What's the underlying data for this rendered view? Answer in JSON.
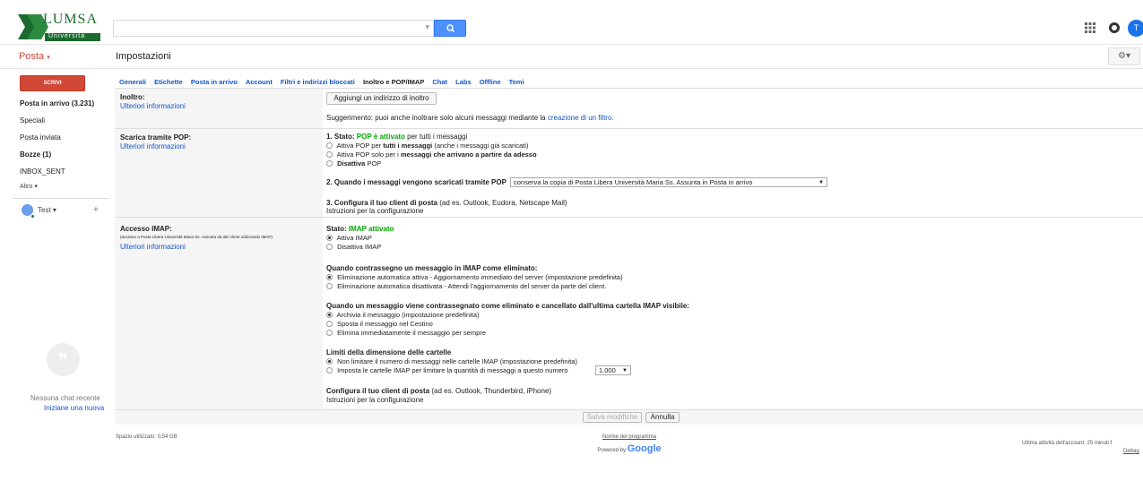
{
  "brand": {
    "name": "LUMSA",
    "subtitle": "Università",
    "color_green": "#1a6b2d"
  },
  "header": {
    "search_value": "",
    "apps_icon": "apps-grid-icon",
    "notif_icon": "notifications-icon",
    "avatar_letter": "T"
  },
  "subbar": {
    "mail_label": "Posta",
    "mail_caret": "▾",
    "page_title": "Impostazioni",
    "gear_label": "⚙▾"
  },
  "sidebar": {
    "compose": "SCRIVI",
    "items": [
      {
        "label": "Posta in arrivo (3.231)"
      },
      {
        "label": "Speciali"
      },
      {
        "label": "Posta inviata"
      },
      {
        "label": "Bozze (1)"
      },
      {
        "label": "INBOX_SENT"
      },
      {
        "label": "Altro ▾"
      }
    ],
    "chat_user": "Test ▾",
    "add_chat": "+",
    "no_chat": "Nessuna chat recente",
    "new_chat": "Iniziane una nuova"
  },
  "tabs": [
    "Generali",
    "Etichette",
    "Posta in arrivo",
    "Account",
    "Filtri e indirizzi bloccati",
    "Inoltro e POP/IMAP",
    "Chat",
    "Labs",
    "Offline",
    "Temi"
  ],
  "forwarding": {
    "title": "Inoltro:",
    "learn_more": "Ulteriori informazioni",
    "add_button": "Aggiungi un indirizzo di inoltro",
    "tip_prefix": "Suggerimento: puoi anche inoltrare solo alcuni messaggi mediante la",
    "tip_link": "creazione di un filtro."
  },
  "pop": {
    "title": "Scarica tramite POP:",
    "learn_more": "Ulteriori informazioni",
    "status_prefix": "1. Stato:",
    "status_value": "POP è attivato",
    "status_suffix": "per tutti i messaggi",
    "opt1_a": "Attiva POP per",
    "opt1_b": "tutti i messaggi",
    "opt1_c": "(anche i messaggi già scaricati)",
    "opt2_a": "Attiva POP solo per i",
    "opt2_b": "messaggi che arrivano a partire da adesso",
    "opt3": "Disattiva",
    "opt3_b": "POP",
    "when_label": "2. Quando i messaggi vengono scaricati tramite POP",
    "when_value": "conserva la copia di Posta Libera Università Maria Ss. Assunta in Posta in arrivo",
    "config_label": "3. Configura il tuo client di posta",
    "config_suffix": "(ad es. Outlook, Eudora, Netscape Mail)",
    "config_link": "Istruzioni per la configurazione"
  },
  "imap": {
    "title": "Accesso IMAP:",
    "note": "(accesso a Posta Libera Università Maria Ss. Assunta da altri client utilizzando IMAP)",
    "learn_more": "Ulteriori informazioni",
    "status_prefix": "Stato:",
    "status_value": "IMAP attivato",
    "enable": "Attiva IMAP",
    "disable": "Disattiva IMAP",
    "deleted_title": "Quando contrassegno un messaggio in IMAP come eliminato:",
    "deleted_opt1": "Eliminazione automatica attiva - Aggiornamento immediato del server (impostazione predefinita)",
    "deleted_opt2": "Eliminazione automatica disattivata - Attendi l'aggiornamento del server da parte del client.",
    "expunge_title": "Quando un messaggio viene contrassegnato come eliminato e cancellato dall'ultima cartella IMAP visibile:",
    "expunge_opt1": "Archivia il messaggio (impostazione predefinita)",
    "expunge_opt2": "Sposta il messaggio nel Cestino",
    "expunge_opt3": "Elimina immediatamente il messaggio per sempre",
    "limits_title": "Limiti della dimensione delle cartelle",
    "limits_opt1": "Non limitare il numero di messaggi nelle cartelle IMAP (impostazione predefinita)",
    "limits_opt2": "Imposta le cartelle IMAP per limitare la quantità di messaggi a questo numero",
    "limits_value": "1.000",
    "config_label": "Configura il tuo client di posta",
    "config_suffix": "(ad es. Outlook, Thunderbird, iPhone)",
    "config_link": "Istruzioni per la configurazione"
  },
  "actions": {
    "save": "Salva modifiche",
    "cancel": "Annulla"
  },
  "footer": {
    "storage": "Spazio utilizzato: 0,54 GB",
    "terms": "Norme del programma",
    "powered": "Powered by",
    "google": "Google",
    "last_activity": "Ultima attività dell'account: 25 minuti f",
    "details": "Dettag"
  }
}
